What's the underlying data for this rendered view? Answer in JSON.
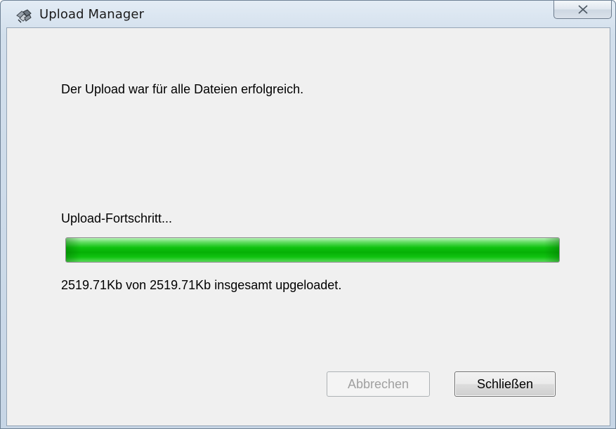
{
  "window": {
    "title": "Upload Manager",
    "icon": "upload-manager-icon"
  },
  "titlebar": {
    "close_icon": "close-icon"
  },
  "main": {
    "message": "Der Upload war für alle Dateien erfolgreich.",
    "progress_label": "Upload-Fortschritt...",
    "progress_value": 1.0,
    "progress_text": "2519.71Kb von 2519.71Kb insgesamt upgeloadet."
  },
  "buttons": {
    "cancel_label": "Abbrechen",
    "cancel_enabled": false,
    "close_label": "Schließen"
  },
  "colors": {
    "progress_green": "#06b006",
    "disabled_text": "#a0a0a0"
  }
}
